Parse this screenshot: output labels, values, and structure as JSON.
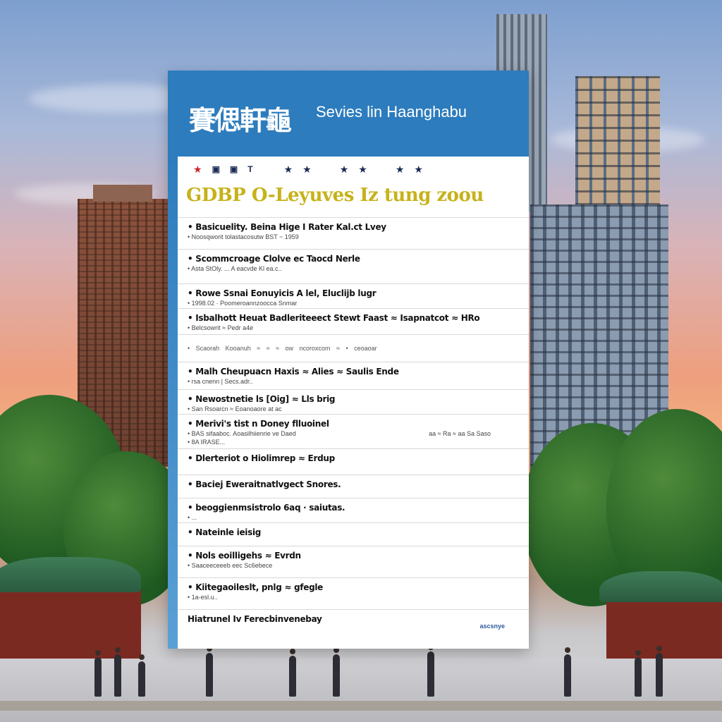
{
  "card": {
    "logo_text": "賽偲軒龜",
    "header_title": "Sevies lin Haanghabu",
    "badges": [
      "T"
    ],
    "main_title": "GDBP  O-Leyuves  Iz tung zoou",
    "rows": [
      {
        "title": "• Basicuelity. Beina Hige  I Rater Kal.ct  Lvey",
        "sub": "• Noosqworit tolastacosutw BST ~ 1959"
      },
      {
        "title": "• Scommcroage  Clolve ec Taocd  Nerle",
        "sub": "• Asta StOly. ... A eacvde  Kl ea.c.."
      },
      {
        "title": "• Rowe Ssnai  Eonuyicis A lel,  Eluclijb  lugr",
        "sub": "• 1998.02  ·  Poomeroannzoocca Snmar"
      },
      {
        "title": "• Isbalhott  Heuat  Badleriteeect  Stewt  Faast  ≈  Isapnatcot  ≈  HRo",
        "sub": "• Belcsowrit  ≈  Pedr a4e"
      },
      {
        "dots": "•  Scaorah      Kooanuh  ≈  ≈  ≈  ow  ncoroxcom  ≈      •  ceoaoar"
      },
      {
        "title": "• Malh Cheupuacn  Haxis  ≈  Alies  ≈  Saulis  Ende",
        "sub": "• rsa cnenn  |  Secs.adr.."
      },
      {
        "title": "• Newostnetie  ls [Oig]  ≈  Lls  brig",
        "sub": "• San Rsoarcn  ≈  Eoanoaore at  ac"
      },
      {
        "title": "• Merivi's tist  n  Doney  flluoinel",
        "sub": "• BAS sifaaboc.  Aoasilhiienrie  ve  Daed",
        "sub2": "• 8A IRASE...",
        "right": "aa ≈  Ra  ≈ aa  Sa Saso"
      },
      {
        "title": "• Dlerteriot  o  Hiolimrep  ≈  Erdup"
      },
      {
        "title": "• Baciej  Eweraitnatlvgect  Snores."
      },
      {
        "title": "• beoggienmsistrolo 6aq  ·  saiutas.",
        "sub": "• ..."
      },
      {
        "title": "• Nateinle  ieisig"
      },
      {
        "title": "• Nols  eoilligehs  ≈  Evrdn",
        "sub": "• Saaceeceeeb  eec  Sc6ebece"
      },
      {
        "title": "• Kiitegaoileslt,  pnlg  ≈  gfegle",
        "sub": "• 1a-esl.u.."
      },
      {
        "title": "  Hiatrunel    Iv  Ferecbinvenebay",
        "badge": "ascsnye"
      }
    ]
  }
}
